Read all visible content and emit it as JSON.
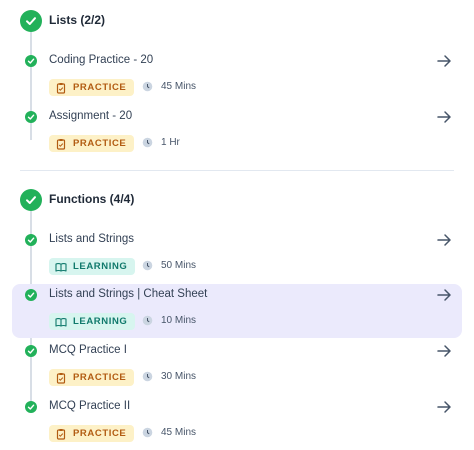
{
  "sections": [
    {
      "title": "Lists (2/2)",
      "items": [
        {
          "title": "Coding Practice - 20",
          "badge": "PRACTICE",
          "duration": "45 Mins"
        },
        {
          "title": "Assignment - 20",
          "badge": "PRACTICE",
          "duration": "1 Hr"
        }
      ]
    },
    {
      "title": "Functions (4/4)",
      "items": [
        {
          "title": "Lists and Strings",
          "badge": "LEARNING",
          "duration": "50 Mins"
        },
        {
          "title": "Lists and Strings | Cheat Sheet",
          "badge": "LEARNING",
          "duration": "10 Mins"
        },
        {
          "title": "MCQ Practice I",
          "badge": "PRACTICE",
          "duration": "30 Mins"
        },
        {
          "title": "MCQ Practice II",
          "badge": "PRACTICE",
          "duration": "45 Mins"
        }
      ]
    }
  ],
  "colors": {
    "complete_green": "#22b15a",
    "practice_bg": "#fdf1c7",
    "practice_text": "#b25c12",
    "learning_bg": "#d7f5ef",
    "learning_text": "#10796c",
    "highlight_bg": "#ebeafc"
  },
  "icons": {
    "section_status": "check-circle-icon",
    "item_status": "check-dot-icon",
    "practice": "clipboard-icon",
    "learning": "book-icon",
    "duration": "clock-icon",
    "open": "arrow-right-icon"
  }
}
